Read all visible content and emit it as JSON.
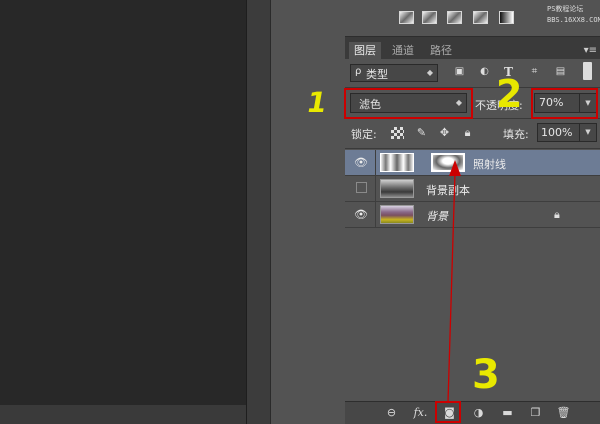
{
  "watermark": {
    "line1": "PS教程论坛",
    "line2": "BBS.16XX8.COM"
  },
  "adjustment_icons": [
    "levels-icon",
    "curves-icon",
    "exposure-icon",
    "channel-mixer-icon",
    "gradient-map-icon"
  ],
  "layers_panel": {
    "tabs": [
      {
        "label": "图层",
        "active": true
      },
      {
        "label": "通道",
        "active": false
      },
      {
        "label": "路径",
        "active": false
      }
    ],
    "menu_glyph": "▾≡",
    "filter": {
      "prefix": "ρ",
      "value": "类型"
    },
    "filter_icons": [
      "pixel-filter-icon",
      "adjustment-filter-icon",
      "type-filter-icon",
      "shape-filter-icon",
      "smart-object-filter-icon"
    ],
    "blend_mode": "滤色",
    "opacity_label": "不透明度:",
    "opacity_value": "70%",
    "lock_label": "锁定:",
    "fill_label": "填充:",
    "fill_value": "100%",
    "layers": [
      {
        "name": "照射线",
        "visible": true,
        "selected": true,
        "has_mask": true
      },
      {
        "name": "背景副本",
        "visible": false,
        "selected": false,
        "has_mask": false
      },
      {
        "name": "背景",
        "visible": true,
        "selected": false,
        "locked": true
      }
    ]
  },
  "annotations": {
    "one": "1",
    "two": "2",
    "three": "3"
  },
  "colors": {
    "panel": "#535353",
    "selected_row": "#6d7c95",
    "annotation_yellow": "#e8e800",
    "annotation_red": "#cc0000"
  }
}
